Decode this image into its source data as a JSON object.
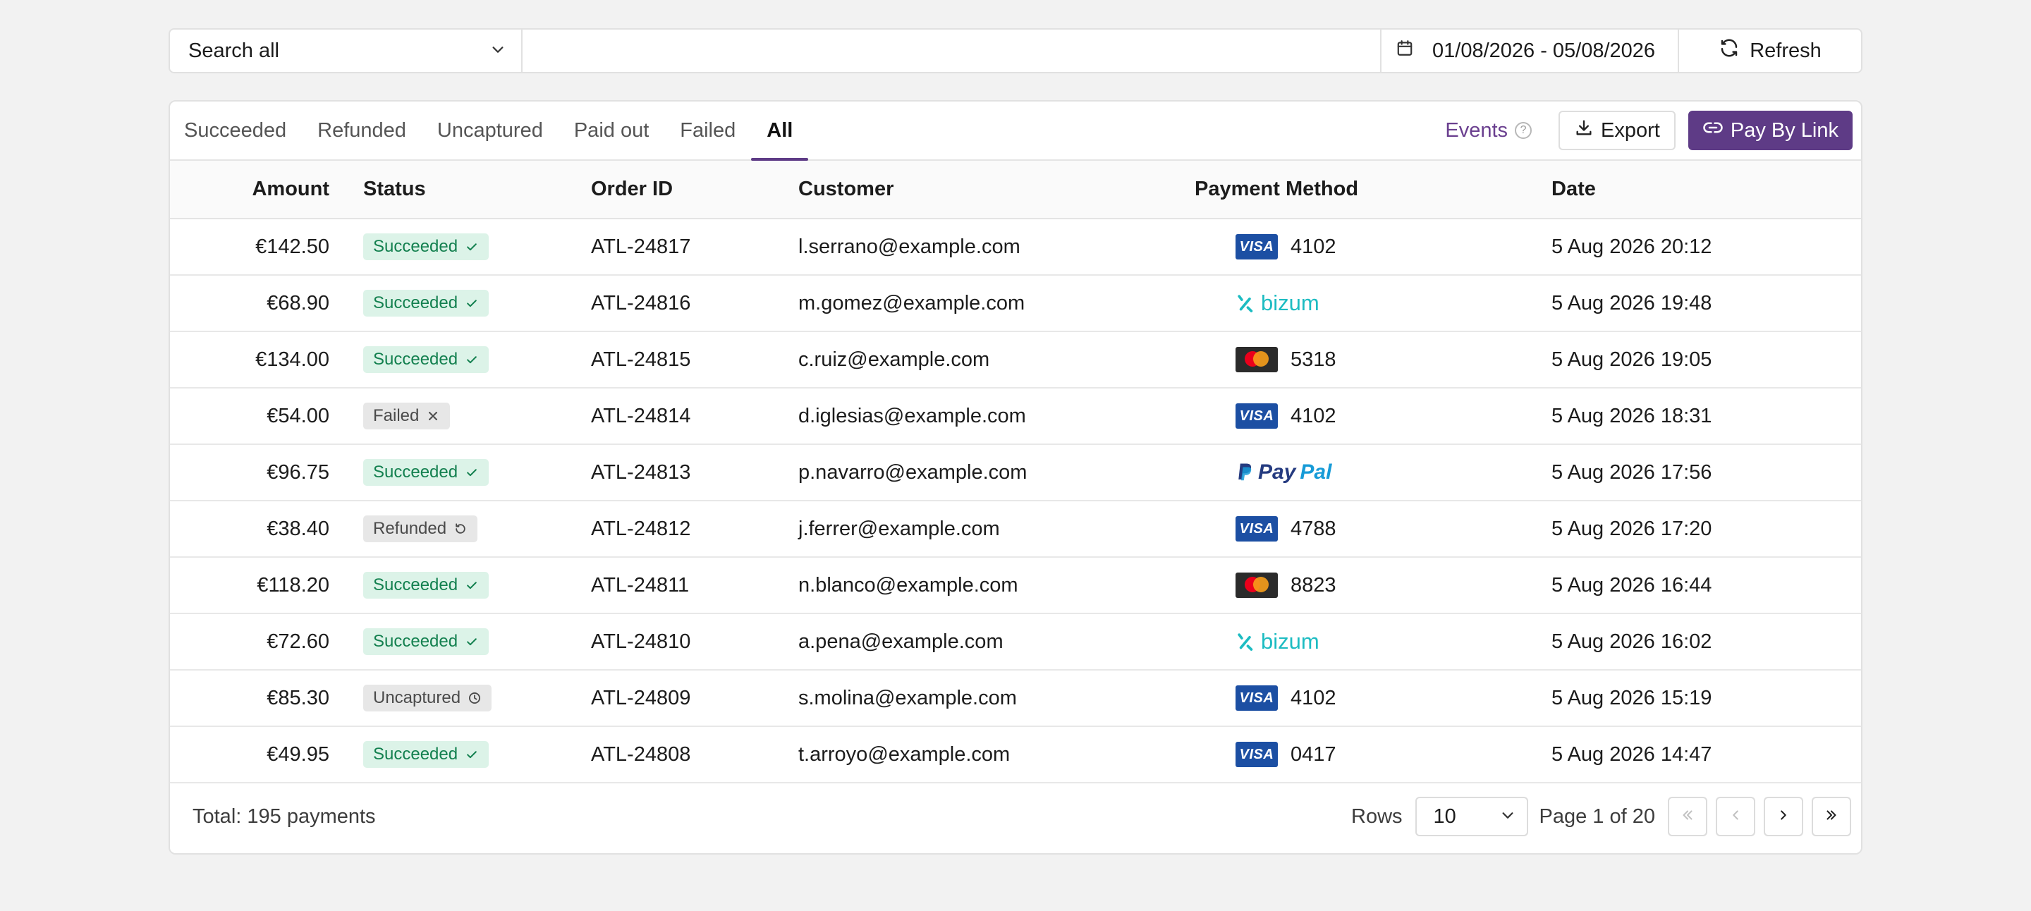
{
  "search": {
    "select_label": "Search all",
    "input_value": "",
    "date_range": "01/08/2026 - 05/08/2026",
    "refresh_label": "Refresh"
  },
  "tabs": [
    {
      "label": "Succeeded",
      "active": false
    },
    {
      "label": "Refunded",
      "active": false
    },
    {
      "label": "Uncaptured",
      "active": false
    },
    {
      "label": "Paid out",
      "active": false
    },
    {
      "label": "Failed",
      "active": false
    },
    {
      "label": "All",
      "active": true
    }
  ],
  "actions": {
    "events_label": "Events",
    "export_label": "Export",
    "pay_by_link_label": "Pay By Link"
  },
  "table": {
    "columns": [
      "Amount",
      "Status",
      "Order ID",
      "Customer",
      "Payment Method",
      "Date"
    ],
    "rows": [
      {
        "amount": "€142.50",
        "status": "Succeeded",
        "order": "ATL-24817",
        "customer": "l.serrano@example.com",
        "method": "visa",
        "last4": "4102",
        "date": "5 Aug 2026 20:12"
      },
      {
        "amount": "€68.90",
        "status": "Succeeded",
        "order": "ATL-24816",
        "customer": "m.gomez@example.com",
        "method": "bizum",
        "last4": "",
        "date": "5 Aug 2026 19:48"
      },
      {
        "amount": "€134.00",
        "status": "Succeeded",
        "order": "ATL-24815",
        "customer": "c.ruiz@example.com",
        "method": "mastercard",
        "last4": "5318",
        "date": "5 Aug 2026 19:05"
      },
      {
        "amount": "€54.00",
        "status": "Failed",
        "order": "ATL-24814",
        "customer": "d.iglesias@example.com",
        "method": "visa",
        "last4": "4102",
        "date": "5 Aug 2026 18:31"
      },
      {
        "amount": "€96.75",
        "status": "Succeeded",
        "order": "ATL-24813",
        "customer": "p.navarro@example.com",
        "method": "paypal",
        "last4": "",
        "date": "5 Aug 2026 17:56"
      },
      {
        "amount": "€38.40",
        "status": "Refunded",
        "order": "ATL-24812",
        "customer": "j.ferrer@example.com",
        "method": "visa",
        "last4": "4788",
        "date": "5 Aug 2026 17:20"
      },
      {
        "amount": "€118.20",
        "status": "Succeeded",
        "order": "ATL-24811",
        "customer": "n.blanco@example.com",
        "method": "mastercard",
        "last4": "8823",
        "date": "5 Aug 2026 16:44"
      },
      {
        "amount": "€72.60",
        "status": "Succeeded",
        "order": "ATL-24810",
        "customer": "a.pena@example.com",
        "method": "bizum",
        "last4": "",
        "date": "5 Aug 2026 16:02"
      },
      {
        "amount": "€85.30",
        "status": "Uncaptured",
        "order": "ATL-24809",
        "customer": "s.molina@example.com",
        "method": "visa",
        "last4": "4102",
        "date": "5 Aug 2026 15:19"
      },
      {
        "amount": "€49.95",
        "status": "Succeeded",
        "order": "ATL-24808",
        "customer": "t.arroyo@example.com",
        "method": "visa",
        "last4": "0417",
        "date": "5 Aug 2026 14:47"
      }
    ]
  },
  "brand_text": {
    "visa": "VISA",
    "bizum": "bizum",
    "paypal_pay": "Pay",
    "paypal_pal": "Pal"
  },
  "footer": {
    "total": "Total: 195 payments",
    "rows_label": "Rows",
    "rows_value": "10",
    "page_label": "Page 1 of 20"
  },
  "colors": {
    "accent": "#5e3b86",
    "success_bg": "#dcf3e8",
    "success_text": "#13804f",
    "neutral_badge_bg": "#e7e7e7",
    "visa_blue": "#1c4fa3",
    "bizum_teal": "#1dbcc2"
  },
  "icons": {
    "search_select": "chevron-down-icon",
    "date_range": "calendar-icon",
    "refresh": "refresh-icon",
    "events": "help-circle-icon",
    "export": "download-icon",
    "pay_by_link": "link-icon",
    "status_succeeded": "check-icon",
    "status_failed": "x-icon",
    "status_refunded": "undo-icon",
    "status_uncaptured": "clock-icon",
    "pager": [
      "first-page-icon",
      "prev-page-icon",
      "next-page-icon",
      "last-page-icon"
    ]
  }
}
